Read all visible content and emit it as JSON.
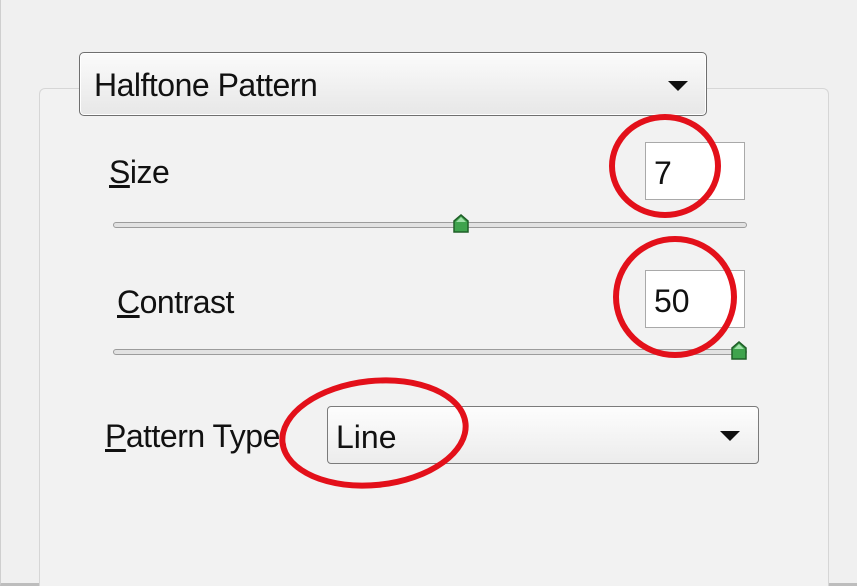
{
  "filter": {
    "selected": "Halftone Pattern"
  },
  "size": {
    "label_prefix": "",
    "label_mnemonic": "S",
    "label_rest": "ize",
    "value": "7",
    "slider_fraction": 0.55
  },
  "contrast": {
    "label_mnemonic": "C",
    "label_rest": "ontrast",
    "value": "50",
    "slider_fraction": 1.0
  },
  "pattern_type": {
    "label_mnemonic": "P",
    "label_rest": "attern Type:",
    "selected": "Line"
  },
  "colors": {
    "annotation": "#e3101a",
    "slider_thumb": "#3fa34d"
  }
}
